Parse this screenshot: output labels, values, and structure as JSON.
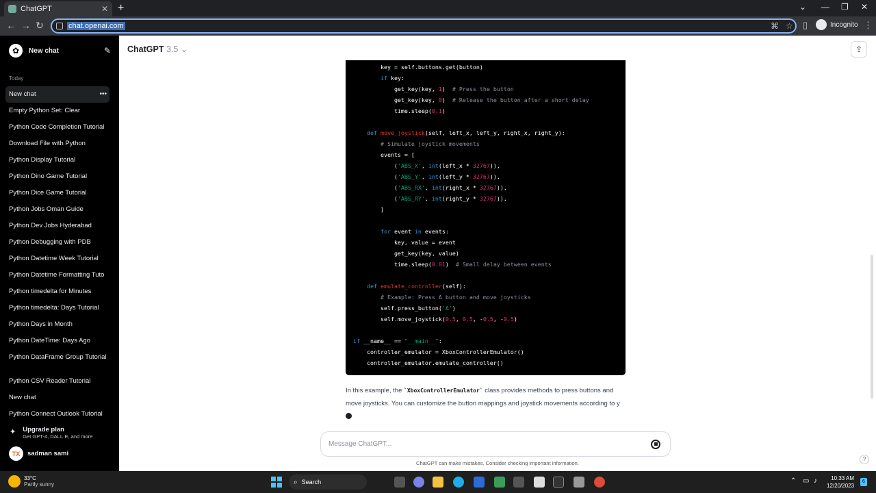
{
  "browser": {
    "tab_title": "ChatGPT",
    "url": "chat.openai.com",
    "incognito_label": "Incognito"
  },
  "sidebar": {
    "new_chat": "New chat",
    "section_today": "Today",
    "items": [
      "New chat",
      "Empty Python Set: Clear",
      "Python Code Completion Tutorial",
      "Download File with Python",
      "Python Display Tutorial",
      "Python Dino Game Tutorial",
      "Python Dice Game Tutorial",
      "Python Jobs Oman Guide",
      "Python Dev Jobs Hyderabad",
      "Python Debugging with PDB",
      "Python Datetime Week Tutorial",
      "Python Datetime Formatting Tuto",
      "Python timedelta for Minutes",
      "Python timedelta: Days Tutorial",
      "Python Days in Month",
      "Python DateTime: Days Ago",
      "Python DataFrame Group Tutorial"
    ],
    "items_older": [
      "Python CSV Reader Tutorial",
      "New chat",
      "Python Connect Outlook Tutorial"
    ],
    "upgrade_title": "Upgrade plan",
    "upgrade_sub": "Get GPT-4, DALL·E, and more",
    "user_initials": "TX",
    "user_name": "sadman sami"
  },
  "main": {
    "model_name": "ChatGPT",
    "model_version": "3.5",
    "prose_before": "In this example, the ",
    "prose_code": "`XboxControllerEmulator`",
    "prose_after": " class provides methods to press buttons and move joysticks. You can customize the button mappings and joystick movements according to y",
    "composer_placeholder": "Message ChatGPT...",
    "disclaimer": "ChatGPT can make mistakes. Consider checking important information.",
    "help": "?"
  },
  "code_lines": [
    "        key = self.buttons.get(button)",
    "        if key:",
    "            get_key(key, 1)  # Press the button",
    "            get_key(key, 0)  # Release the button after a short delay",
    "            time.sleep(0.1)",
    "",
    "    def move_joystick(self, left_x, left_y, right_x, right_y):",
    "        # Simulate joystick movements",
    "        events = [",
    "            ('ABS_X', int(left_x * 32767)),",
    "            ('ABS_Y', int(left_y * 32767)),",
    "            ('ABS_RX', int(right_x * 32767)),",
    "            ('ABS_RY', int(right_y * 32767)),",
    "        ]",
    "",
    "        for event in events:",
    "            key, value = event",
    "            get_key(key, value)",
    "            time.sleep(0.01)  # Small delay between events",
    "",
    "    def emulate_controller(self):",
    "        # Example: Press A button and move joysticks",
    "        self.press_button('A')",
    "        self.move_joystick(0.5, 0.5, -0.5, -0.5)",
    "",
    "if __name__ == \"__main__\":",
    "    controller_emulator = XboxControllerEmulator()",
    "    controller_emulator.emulate_controller()"
  ],
  "taskbar": {
    "temp": "33°C",
    "weather": "Partly sunny",
    "search_label": "Search",
    "time": "10:33 AM",
    "date": "12/20/2023",
    "notif_count": "6"
  }
}
